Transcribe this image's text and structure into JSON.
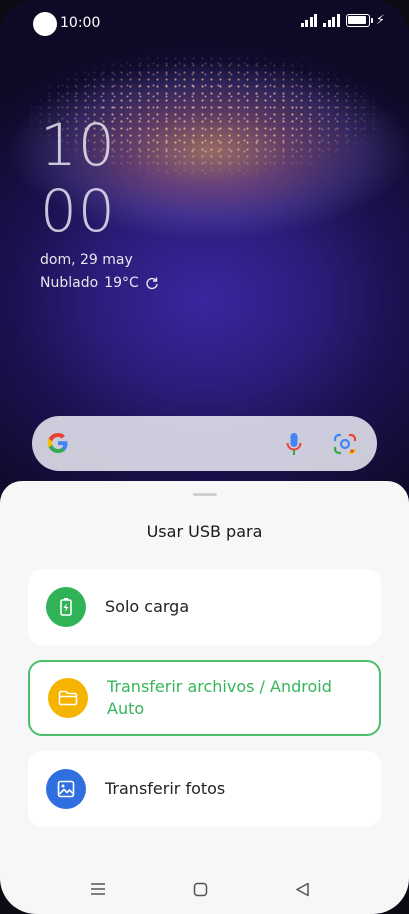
{
  "status": {
    "time": "10:00"
  },
  "lockscreen": {
    "hour": "10",
    "minute": "00",
    "date": "dom, 29 may",
    "weather": "Nublado",
    "temperature": "19°C"
  },
  "sheet": {
    "title": "Usar USB para",
    "options": [
      {
        "label": "Solo carga",
        "icon": "battery-charge-icon",
        "color": "#2fb356"
      },
      {
        "label": "Transferir archivos / Android Auto",
        "icon": "folder-icon",
        "color": "#f5b400",
        "selected": true
      },
      {
        "label": "Transferir fotos",
        "icon": "image-icon",
        "color": "#2f6fe0"
      }
    ]
  },
  "colors": {
    "accent": "#4cbf6b",
    "sheet_bg": "#f7f7f7"
  }
}
